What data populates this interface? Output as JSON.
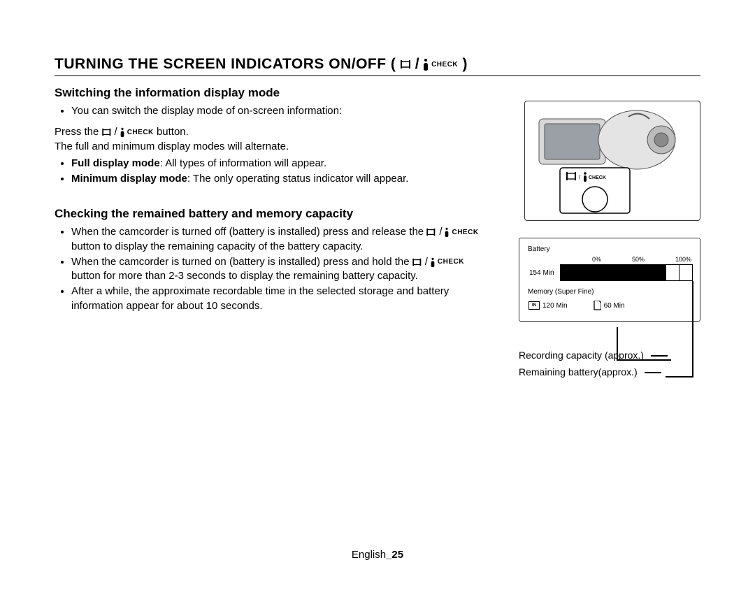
{
  "title_prefix": "TURNING THE SCREEN INDICATORS ON/OFF ( ",
  "title_suffix": " )",
  "icon_label": "CHECK",
  "section1": {
    "heading": "Switching the information display mode",
    "bullet1": "You can switch the display mode of on-screen information:",
    "press_pre": "Press the ",
    "press_post": " button.",
    "alt_line": "The full and minimum display modes will alternate.",
    "full_label": "Full display mode",
    "full_text": ": All types of information will appear.",
    "min_label": "Minimum display mode",
    "min_text": ": The only operating status indicator will appear."
  },
  "section2": {
    "heading": "Checking the remained battery and memory capacity",
    "b1_pre": "When the camcorder is turned off (battery is installed) press and release the ",
    "b1_post": " button to display the remaining capacity of the battery capacity.",
    "b2_pre": "When the camcorder is turned on (battery is installed) press and hold the ",
    "b2_post": " button for more than 2-3 seconds to display the remaining battery capacity.",
    "b3": "After a while, the approximate recordable time in the selected storage and battery information appear for about 10 seconds."
  },
  "info_screen": {
    "battery_label": "Battery",
    "pct0": "0%",
    "pct50": "50%",
    "pct100": "100%",
    "bat_time": "154 Min",
    "filled_segments": 8,
    "total_segments": 10,
    "memory_label": "Memory (Super Fine)",
    "mem_in_icon": "IN",
    "mem_in_time": "120 Min",
    "mem_card_time": "60 Min"
  },
  "callouts": {
    "recording": "Recording capacity (approx.)",
    "remaining": "Remaining battery(approx.)"
  },
  "footer_lang": "English",
  "footer_page": "_25"
}
